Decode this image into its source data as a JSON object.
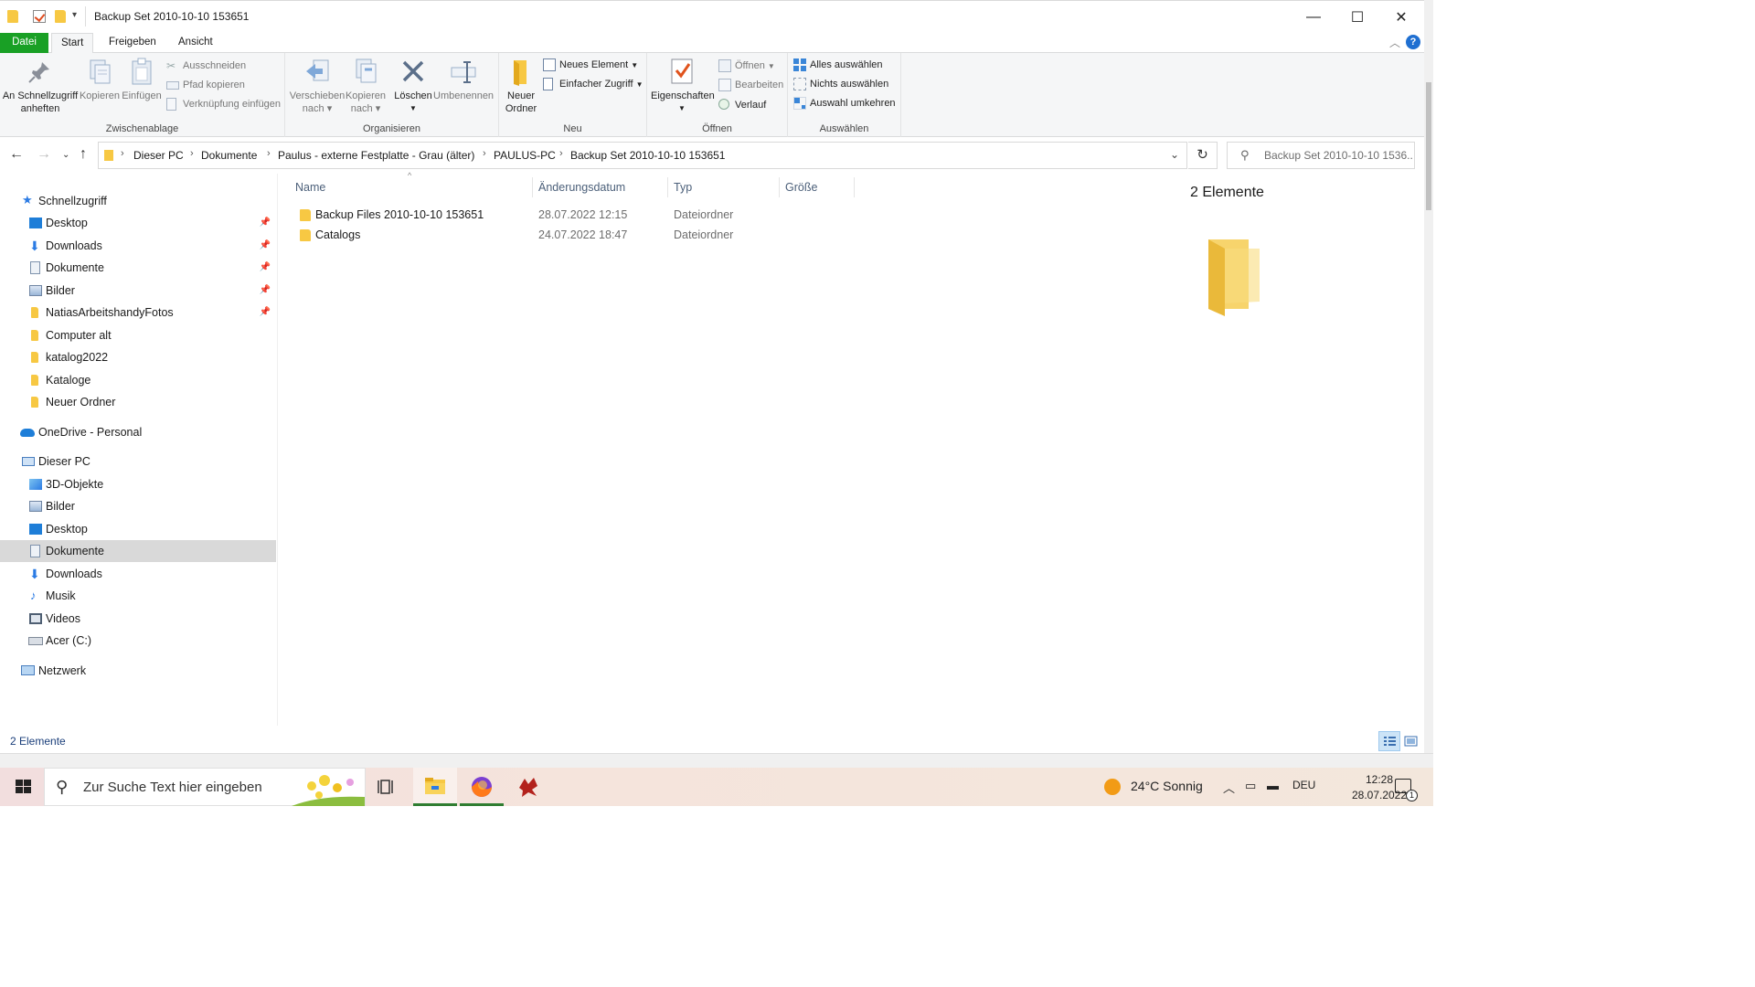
{
  "window": {
    "title": "Backup Set 2010-10-10 153651",
    "minimize": "—",
    "maximize": "☐",
    "close": "✕"
  },
  "ribbon_tabs": [
    "Datei",
    "Start",
    "Freigeben",
    "Ansicht"
  ],
  "ribbon": {
    "clipboard": {
      "label": "Zwischenablage",
      "pin": "An Schnellzugriff anheften",
      "pin_line1": "An Schnellzugriff",
      "pin_line2": "anheften",
      "copy": "Kopieren",
      "paste": "Einfügen",
      "cut": "Ausschneiden",
      "copy_path": "Pfad kopieren",
      "paste_shortcut": "Verknüpfung einfügen"
    },
    "organize": {
      "label": "Organisieren",
      "move_line1": "Verschieben",
      "move_line2": "nach",
      "copyto_line1": "Kopieren",
      "copyto_line2": "nach",
      "delete": "Löschen",
      "rename": "Umbenennen"
    },
    "new": {
      "label": "Neu",
      "new_folder_line1": "Neuer",
      "new_folder_line2": "Ordner",
      "new_item": "Neues Element",
      "easy_access": "Einfacher Zugriff"
    },
    "open": {
      "label": "Öffnen",
      "properties": "Eigenschaften",
      "open": "Öffnen",
      "edit": "Bearbeiten",
      "history": "Verlauf"
    },
    "select": {
      "label": "Auswählen",
      "select_all": "Alles auswählen",
      "select_none": "Nichts auswählen",
      "invert": "Auswahl umkehren"
    }
  },
  "breadcrumb": [
    "Dieser PC",
    "Dokumente",
    "Paulus - externe Festplatte - Grau (älter)",
    "PAULUS-PC",
    "Backup Set 2010-10-10 153651"
  ],
  "search": {
    "placeholder": "Backup Set 2010-10-10 1536..."
  },
  "navpane": {
    "quick_access": "Schnellzugriff",
    "quick_items": [
      {
        "label": "Desktop",
        "pinned": true
      },
      {
        "label": "Downloads",
        "pinned": true
      },
      {
        "label": "Dokumente",
        "pinned": true
      },
      {
        "label": "Bilder",
        "pinned": true
      },
      {
        "label": "NatiasArbeitshandyFotos",
        "pinned": true
      },
      {
        "label": "Computer alt",
        "pinned": false
      },
      {
        "label": "katalog2022",
        "pinned": false
      },
      {
        "label": "Kataloge",
        "pinned": false
      },
      {
        "label": "Neuer Ordner",
        "pinned": false
      }
    ],
    "onedrive": "OneDrive - Personal",
    "this_pc": "Dieser PC",
    "pc_items": [
      "3D-Objekte",
      "Bilder",
      "Desktop",
      "Dokumente",
      "Downloads",
      "Musik",
      "Videos",
      "Acer (C:)"
    ],
    "selected": "Dokumente",
    "network": "Netzwerk"
  },
  "columns": [
    "Name",
    "Änderungsdatum",
    "Typ",
    "Größe"
  ],
  "files": [
    {
      "name": "Backup Files 2010-10-10 153651",
      "modified": "28.07.2022 12:15",
      "type": "Dateiordner",
      "size": ""
    },
    {
      "name": "Catalogs",
      "modified": "24.07.2022 18:47",
      "type": "Dateiordner",
      "size": ""
    }
  ],
  "preview": {
    "title": "2 Elemente"
  },
  "status": {
    "text": "2 Elemente"
  },
  "taskbar": {
    "search_placeholder": "Zur Suche Text hier eingeben",
    "weather": "24°C  Sonnig",
    "language": "DEU",
    "time": "12:28",
    "date": "28.07.2022",
    "notification_count": "1"
  },
  "colors": {
    "datei_tab": "#19a025",
    "folder": "#f7c843",
    "accent_blue": "#1f6fd1",
    "selected_nav": "#d9d9d9"
  }
}
